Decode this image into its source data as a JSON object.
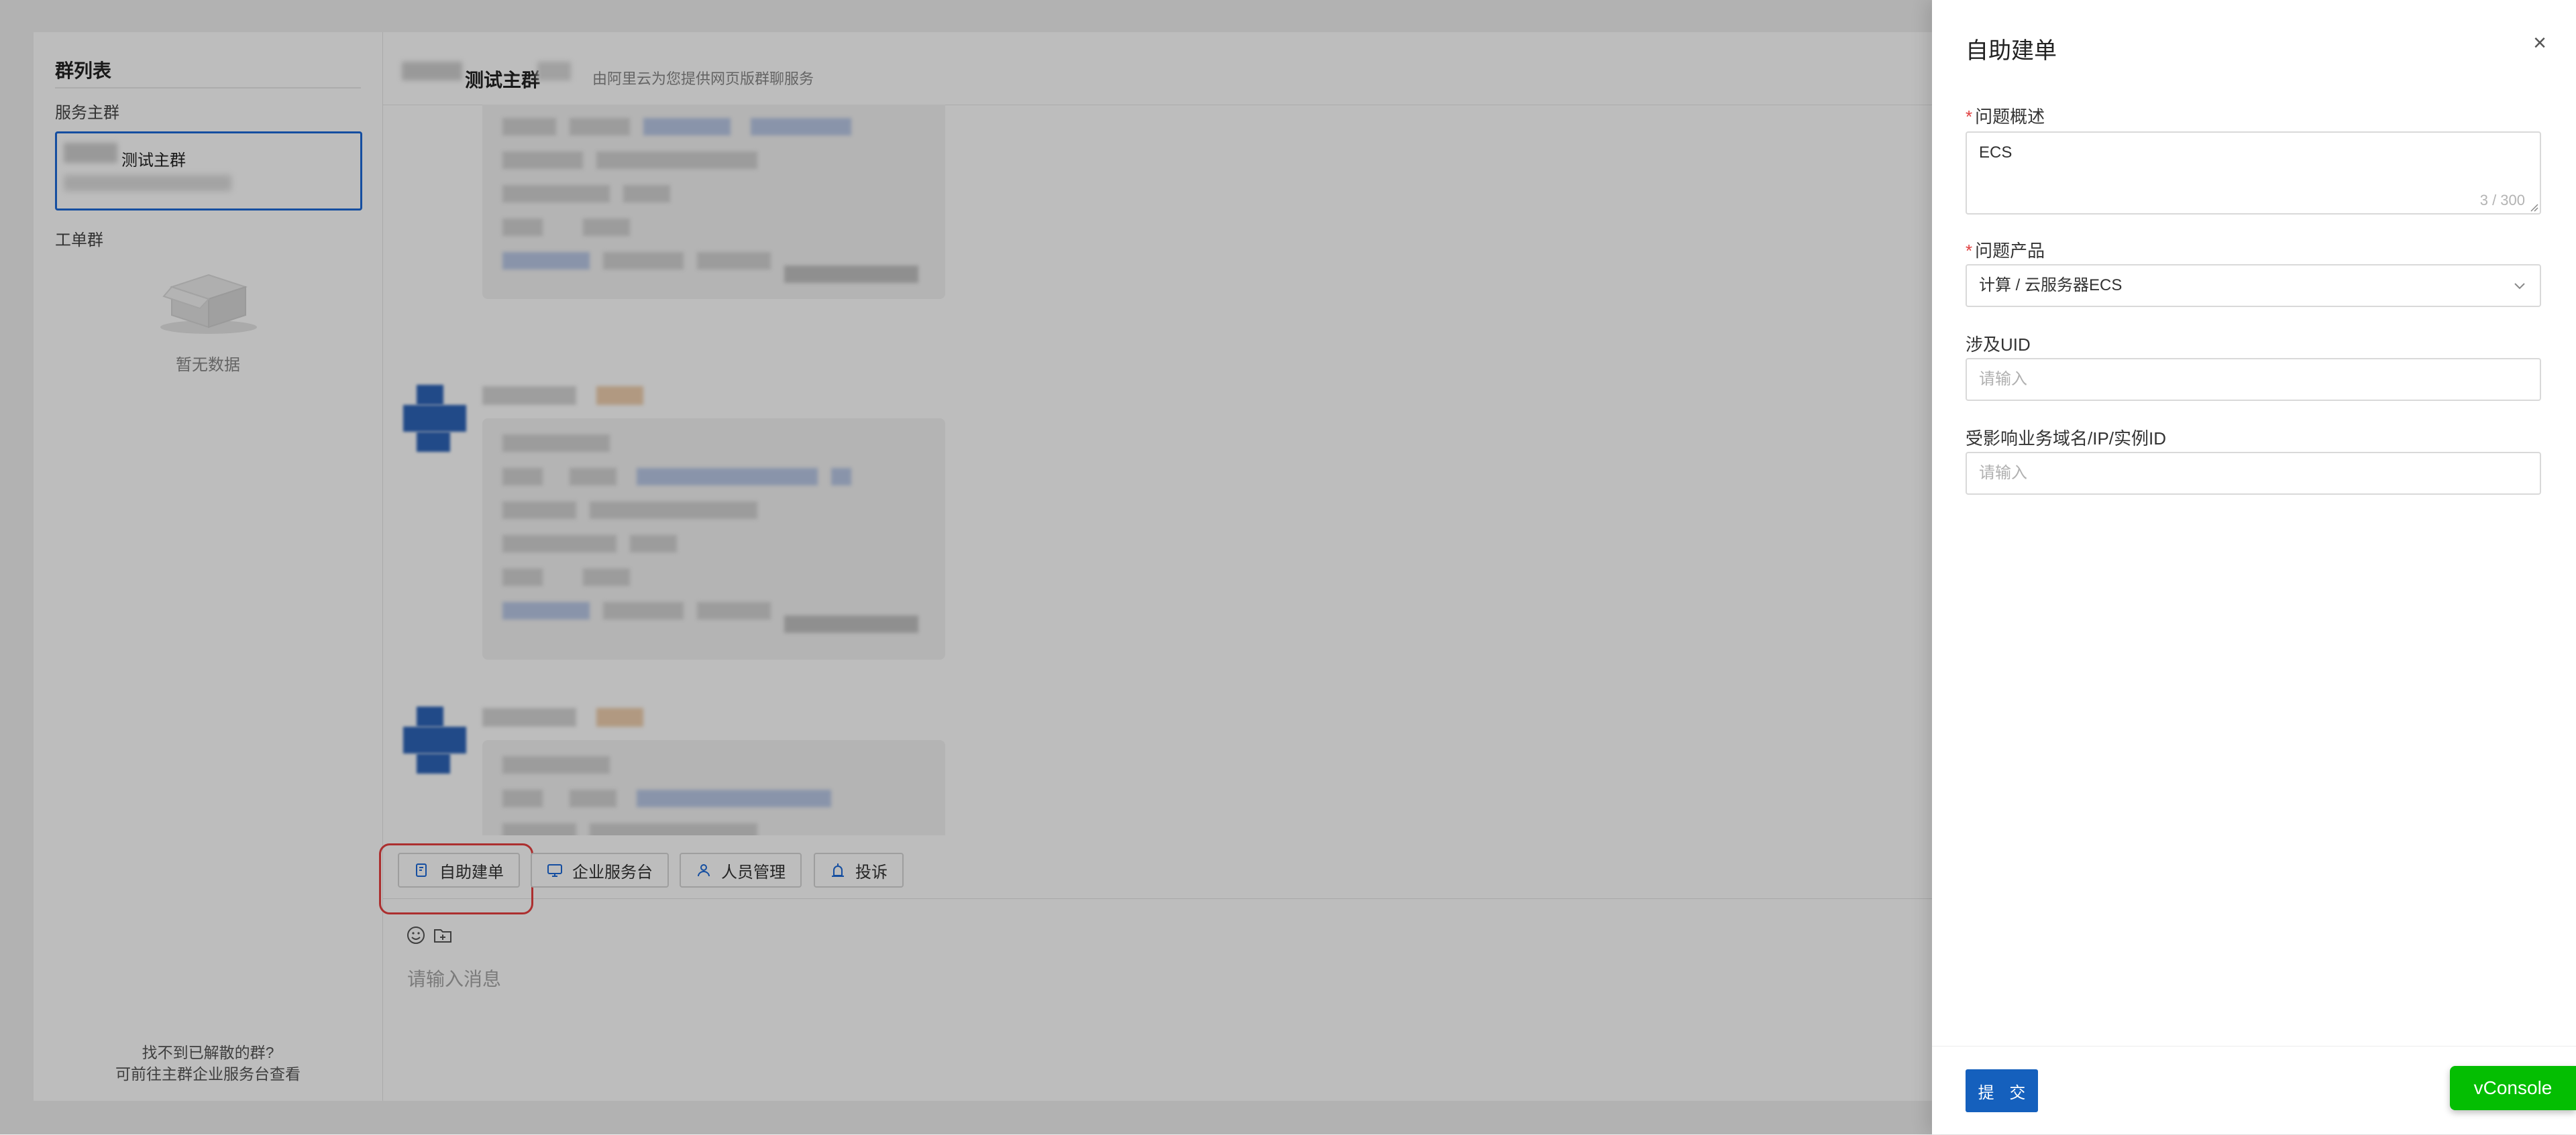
{
  "sidebar": {
    "title": "群列表",
    "service_section": "服务主群",
    "group_name": "测试主群",
    "ticket_section": "工单群",
    "empty_text": "暂无数据",
    "footer_line1": "找不到已解散的群?",
    "footer_line2": "可前往主群企业服务台查看"
  },
  "chat": {
    "title": "测试主群",
    "subtitle": "由阿里云为您提供网页版群聊服务",
    "toolbar": {
      "self_ticket": "自助建单",
      "enterprise_desk": "企业服务台",
      "member_manage": "人员管理",
      "complaint": "投诉"
    },
    "input_placeholder": "请输入消息"
  },
  "drawer": {
    "title": "自助建单",
    "close": "×",
    "fields": {
      "summary_label": "问题概述",
      "summary_value": "ECS",
      "summary_count": "3 / 300",
      "product_label": "问题产品",
      "product_value": "计算 / 云服务器ECS",
      "uid_label": "涉及UID",
      "uid_placeholder": "请输入",
      "affected_label": "受影响业务域名/IP/实例ID",
      "affected_placeholder": "请输入"
    },
    "submit": "提 交"
  },
  "vconsole": "vConsole",
  "colors": {
    "primary": "#1560bd",
    "highlight": "#e84040",
    "vconsole": "#04be02",
    "required": "#e04040"
  }
}
